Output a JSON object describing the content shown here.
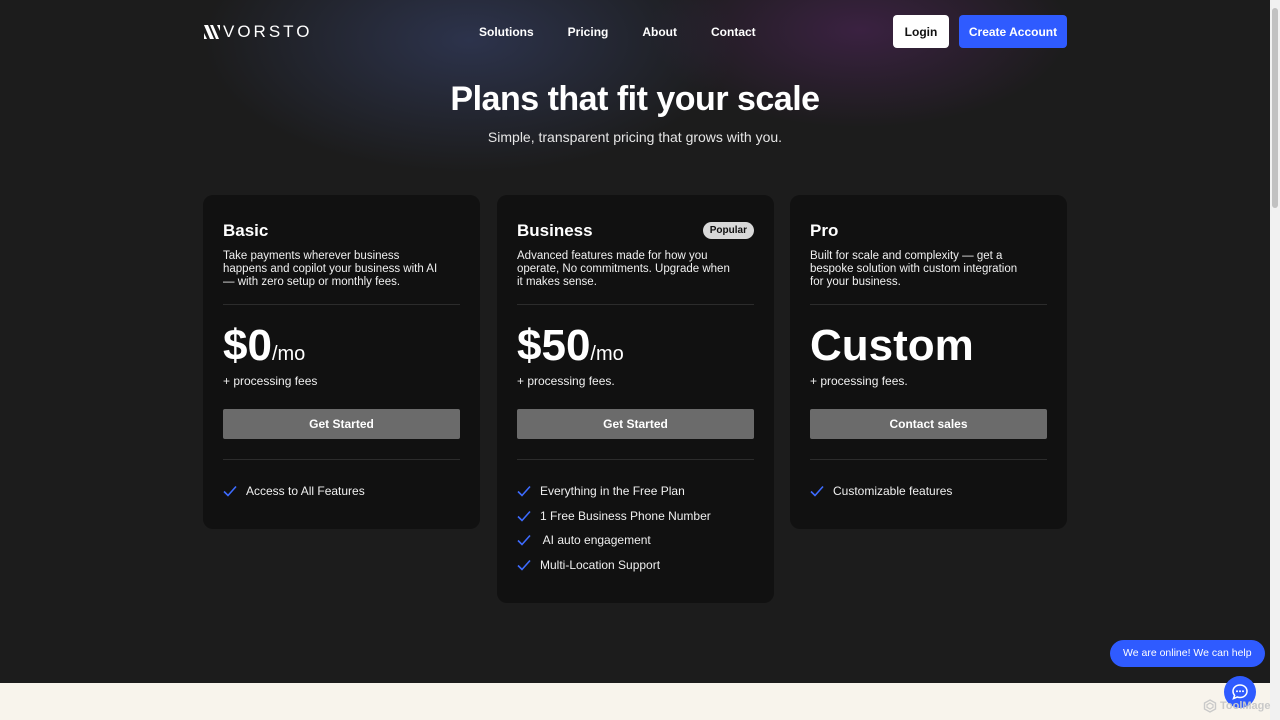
{
  "brand": {
    "name": "VORSTO",
    "logo_icon": "vorsto-logo-icon"
  },
  "nav": {
    "links": [
      "Solutions",
      "Pricing",
      "About",
      "Contact"
    ],
    "login_label": "Login",
    "create_account_label": "Create Account"
  },
  "hero": {
    "title": "Plans that fit your scale",
    "subtitle": "Simple, transparent pricing that grows with you."
  },
  "plans": [
    {
      "name": "Basic",
      "badge": "",
      "description": "Take payments wherever business happens and copilot your business with AI — with zero setup or monthly fees.",
      "price": "$0",
      "period": "/mo",
      "price_note": "+ processing fees",
      "cta": "Get Started",
      "features": [
        "Access to All Features"
      ]
    },
    {
      "name": "Business",
      "badge": "Popular",
      "description": "Advanced features made for how you operate, No commitments. Upgrade when it makes sense.",
      "price": "$50",
      "period": "/mo",
      "price_note": "+ processing fees.",
      "cta": "Get Started",
      "features": [
        "Everything in the Free Plan",
        "1 Free Business Phone Number",
        " AI auto engagement",
        "Multi-Location Support"
      ]
    },
    {
      "name": "Pro",
      "badge": "",
      "description": "Built for scale and complexity — get a bespoke solution with custom integration for your business.",
      "price": "Custom",
      "period": "",
      "price_note": "+ processing fees.",
      "cta": "Contact sales",
      "features": [
        "Customizable features"
      ]
    }
  ],
  "chat": {
    "message": "We are online! We can help",
    "icon": "chat-bubble-icon"
  },
  "watermark": {
    "text": "ToolMage",
    "icon": "toolmage-logo-icon"
  },
  "colors": {
    "accent": "#2f5bff",
    "background": "#1c1c1c",
    "card": "#111111",
    "check": "#3d6bff",
    "button_gray": "#6b6b6b",
    "footer_band": "#f8f4ec"
  }
}
